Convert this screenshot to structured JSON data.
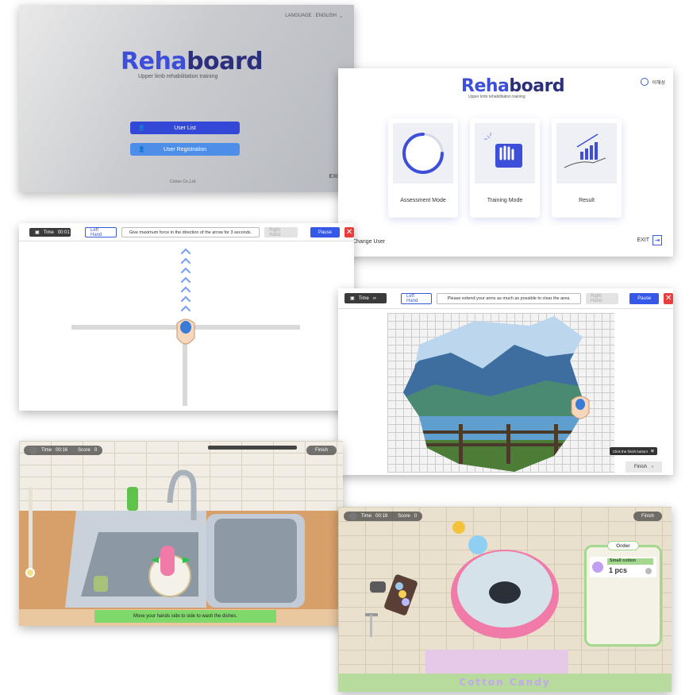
{
  "login": {
    "language_label": "LANGUAGE : ENGLISH",
    "logo_reha": "Reha",
    "logo_board": "board",
    "subtitle": "Upper limb rehabilitation training",
    "user_list": "User List",
    "user_registration": "User Registration",
    "exit": "EXIT",
    "copyright": "Cotras Co.,Ltd."
  },
  "mode": {
    "logo_reha": "Reha",
    "logo_board": "board",
    "subtitle": "Upper limb rehabilitation training",
    "username": "이해성",
    "cards": [
      {
        "label": "Assessment Mode"
      },
      {
        "label": "Training Mode"
      },
      {
        "label": "Result"
      }
    ],
    "change_user": "Change User",
    "exit": "EXIT"
  },
  "assessment": {
    "time_label": "Time",
    "time_value": "00:01",
    "left_hand": "Left Hand",
    "instruction": "Give maximum force in the direction of the arrow for 3 seconds.",
    "right_hand": "Right Hand",
    "pause": "Pause"
  },
  "puzzle": {
    "time_label": "Time",
    "time_value": "∞",
    "left_hand": "Left Hand",
    "instruction": "Please extend your arms as much as possible to clear the area.",
    "right_hand": "Right Hand",
    "pause": "Pause",
    "tooltip": "Click the finish button!",
    "finish": "Finish"
  },
  "dishes": {
    "time_label": "Time",
    "time_value": "00:16",
    "score_label": "Score",
    "score_value": "0",
    "finish": "Finish",
    "banner": "Move your hands side to side to wash the dishes."
  },
  "candy": {
    "time_label": "Time",
    "time_value": "00:19",
    "score_label": "Score",
    "score_value": "0",
    "finish": "Finish",
    "order_title": "Order",
    "order_item": "Small cotton",
    "order_qty": "1 pcs",
    "mat_text": "Cotton Candy"
  },
  "colors": {
    "brand_blue": "#3d4fd8",
    "brand_navy": "#2c2f7a",
    "pause_blue": "#3558e8",
    "close_red": "#e93e3e",
    "banner_green": "#7ed86a",
    "candy_pink": "#f07aa8"
  }
}
